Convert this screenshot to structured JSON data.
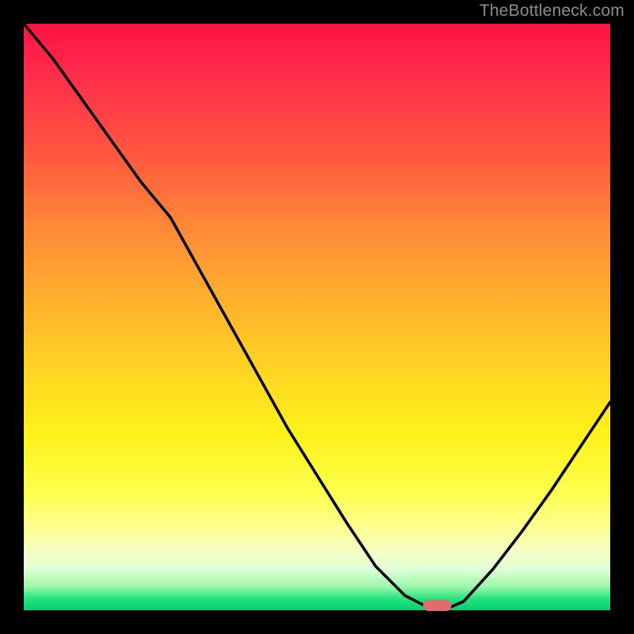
{
  "watermark": "TheBottleneck.com",
  "chart_data": {
    "type": "line",
    "title": "",
    "xlabel": "",
    "ylabel": "",
    "x": [
      0.0,
      0.05,
      0.1,
      0.15,
      0.2,
      0.25,
      0.3,
      0.35,
      0.4,
      0.45,
      0.5,
      0.55,
      0.6,
      0.65,
      0.695,
      0.72,
      0.75,
      0.8,
      0.85,
      0.9,
      0.95,
      1.0
    ],
    "values": [
      1.0,
      0.94,
      0.87,
      0.8,
      0.73,
      0.67,
      0.58,
      0.49,
      0.4,
      0.31,
      0.23,
      0.15,
      0.075,
      0.025,
      0.002,
      0.002,
      0.015,
      0.07,
      0.135,
      0.205,
      0.28,
      0.355
    ],
    "ylim": [
      0,
      1
    ],
    "xlim": [
      0,
      1
    ],
    "marker": {
      "shape": "rounded-rect",
      "x": 0.705,
      "y": 0.002,
      "color": "#e26b6f"
    },
    "background_gradient": {
      "direction": "top-to-bottom",
      "stops": [
        {
          "pos": 0.0,
          "color": "#ff1243"
        },
        {
          "pos": 0.35,
          "color": "#ff8a36"
        },
        {
          "pos": 0.6,
          "color": "#ffd722"
        },
        {
          "pos": 0.8,
          "color": "#fcff4e"
        },
        {
          "pos": 0.92,
          "color": "#e0ffd8"
        },
        {
          "pos": 1.0,
          "color": "#05cf6f"
        }
      ]
    }
  }
}
